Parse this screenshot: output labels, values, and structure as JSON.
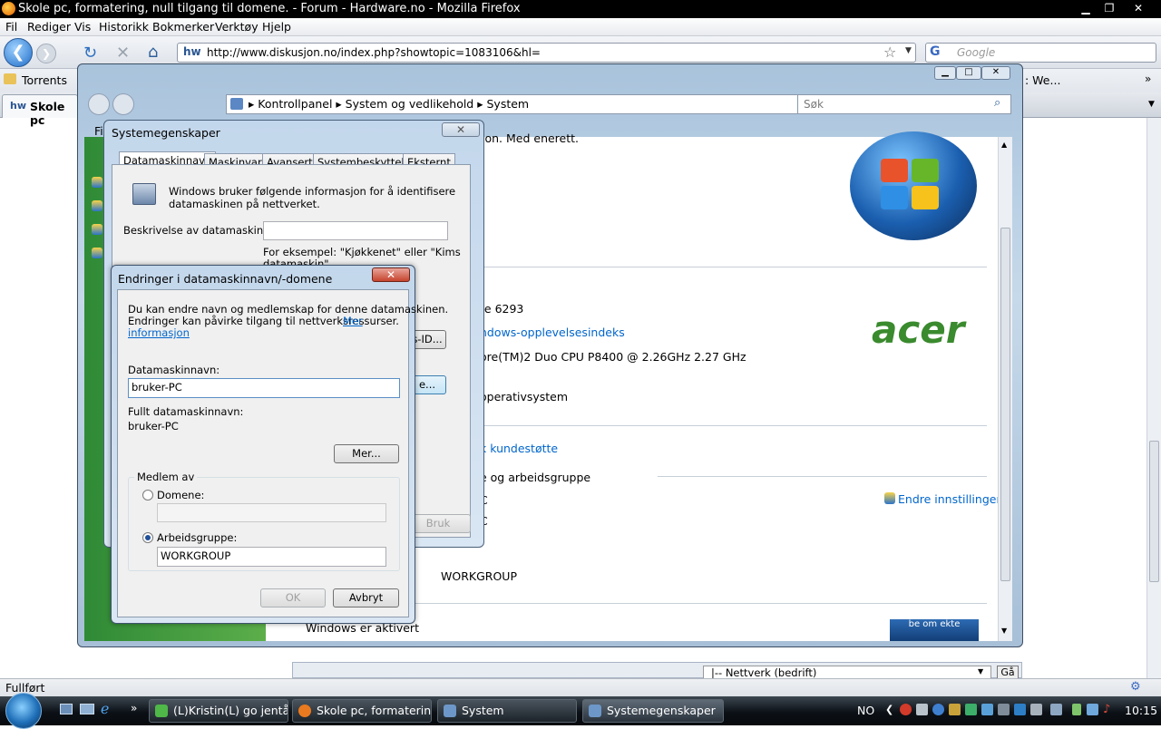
{
  "firefox": {
    "title": "Skole pc, formatering, null tilgang til domene. - Forum - Hardware.no - Mozilla Firefox",
    "menu": [
      "Fil",
      "Rediger",
      "Vis",
      "Historikk",
      "Bokmerker",
      "Verktøy",
      "Hjelp"
    ],
    "url": "http://www.diskusjon.no/index.php?showtopic=1083106&hl=",
    "search_placeholder": "Google",
    "bookmarks": [
      "Torrents"
    ],
    "tab_label": "Skole pc",
    "status": "Fullført",
    "page_select": "|-- Nettverk (bedrift)",
    "page_go": "Gå"
  },
  "system_window": {
    "breadcrumb": [
      "Kontrollpanel",
      "System og vedlikehold",
      "System"
    ],
    "search_placeholder": "Søk",
    "menu_fragment": "Fi",
    "content": {
      "copyright_fragment": "ion. Med enerett.",
      "rating_fragment": "te 6293",
      "experience_link": "ndows-opplevelsesindeks",
      "processor_line": "ore(TM)2 Duo CPU     P8400  @ 2.26GHz   2.27 GHz",
      "os_fragment": "operativsystem",
      "support_link": "k kundestøtte",
      "section_fragment": "e og arbeidsgruppe",
      "row_c1": "C",
      "row_c2": "C",
      "change_settings": "Endre innstillinger",
      "workgroup_value": "WORKGROUP",
      "activated": "Windows er aktivert",
      "acer_logo": "acer",
      "genuine_badge": "be om ekte"
    }
  },
  "system_properties": {
    "title": "Systemegenskaper",
    "tabs": [
      "Datamaskinnavn",
      "Maskinvare",
      "Avansert",
      "Systembeskyttelse",
      "Eksternt"
    ],
    "intro": [
      "Windows bruker følgende informasjon for å identifisere",
      "datamaskinen på nettverket."
    ],
    "description_label": "Beskrivelse av datamaskinen:",
    "example": [
      "For eksempel: \"Kjøkkenet\" eller \"Kims",
      "datamaskin\"."
    ],
    "network_id_fragment": "s-ID...",
    "change_fragment": "e...",
    "apply": "Bruk"
  },
  "change_dialog": {
    "title": "Endringer i datamaskinnavn/-domene",
    "intro_line1": "Du kan endre navn og medlemskap for denne datamaskinen.",
    "intro_line2": "Endringer kan påvirke tilgang til nettverksressurser.",
    "more_info_link_a": "Mer",
    "more_info_link_b": "informasjon",
    "computer_name_label": "Datamaskinnavn:",
    "computer_name_value": "bruker-PC",
    "full_name_label": "Fullt datamaskinnavn:",
    "full_name_value": "bruker-PC",
    "more_button": "Mer...",
    "member_of": "Medlem av",
    "domain_label": "Domene:",
    "domain_value": "",
    "workgroup_label": "Arbeidsgruppe:",
    "workgroup_value": "WORKGROUP",
    "ok": "OK",
    "cancel": "Avbryt"
  },
  "taskbar": {
    "buttons": [
      "(L)Kristin(L) go jentå...",
      "Skole pc, formaterin...",
      "System",
      "Systemegenskaper"
    ],
    "language": "NO",
    "clock": "10:15"
  }
}
